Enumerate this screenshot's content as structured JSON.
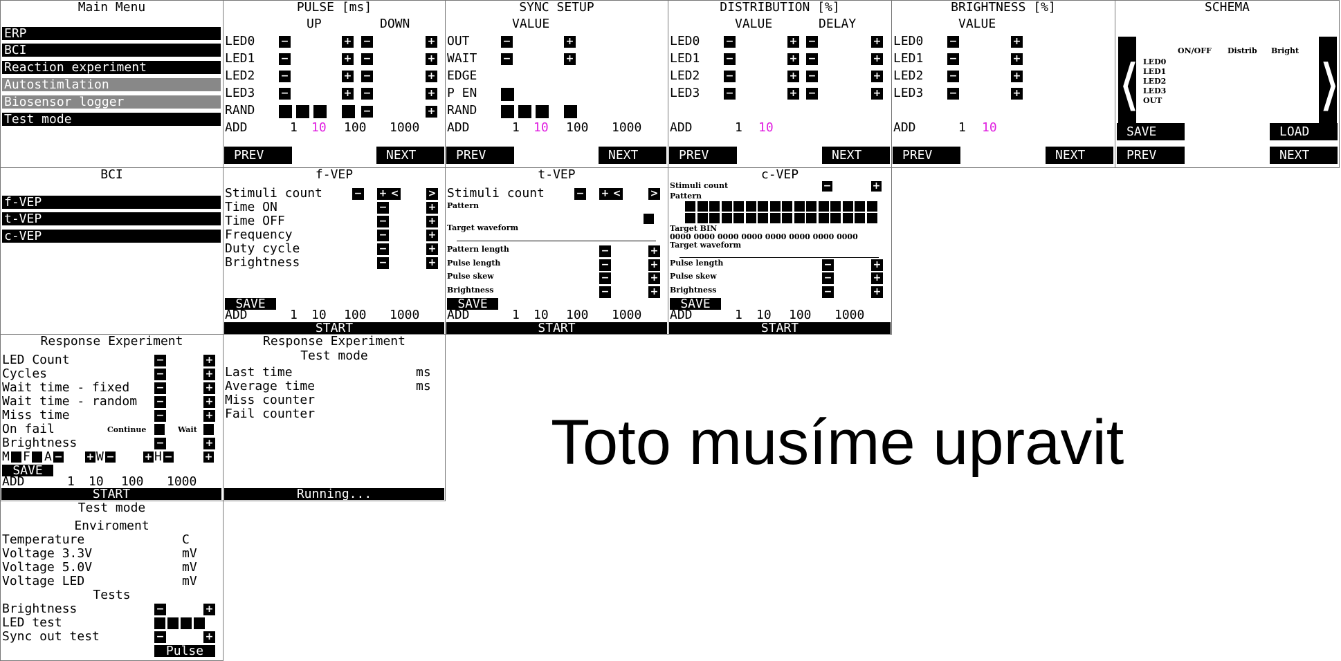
{
  "main_menu": {
    "title": "Main Menu",
    "items": [
      "ERP",
      "BCI",
      "Reaction experiment",
      "Autostimlation",
      "Biosensor logger",
      "Test mode"
    ]
  },
  "pulse": {
    "title": "PULSE [ms]",
    "col_up": "UP",
    "col_down": "DOWN",
    "rows": [
      "LED0",
      "LED1",
      "LED2",
      "LED3",
      "RAND"
    ]
  },
  "sync": {
    "title": "SYNC SETUP",
    "col_value": "VALUE",
    "rows": [
      "OUT",
      "WAIT",
      "EDGE",
      "P EN",
      "RAND"
    ]
  },
  "distribution": {
    "title": "DISTRIBUTION [%]",
    "col_value": "VALUE",
    "col_delay": "DELAY",
    "rows": [
      "LED0",
      "LED1",
      "LED2",
      "LED3"
    ]
  },
  "brightness": {
    "title": "BRIGHTNESS [%]",
    "col_value": "VALUE",
    "rows": [
      "LED0",
      "LED1",
      "LED2",
      "LED3"
    ]
  },
  "schema": {
    "title": "SCHEMA",
    "col_onoff": "ON/OFF",
    "col_distrib": "Distrib",
    "col_bright": "Bright",
    "rows": [
      "LED0",
      "LED1",
      "LED2",
      "LED3",
      "OUT"
    ],
    "save": "SAVE",
    "load": "LOAD",
    "prev_arrow": "⟨",
    "next_arrow": "⟩"
  },
  "common": {
    "add": "ADD",
    "steps": [
      "1",
      "10",
      "100",
      "1000"
    ],
    "prev": "PREV",
    "next": "NEXT",
    "save": "SAVE",
    "start": "START",
    "minus": "−",
    "plus": "+",
    "left": "<",
    "right": ">"
  },
  "bci": {
    "title": "BCI",
    "items": [
      "f-VEP",
      "t-VEP",
      "c-VEP"
    ]
  },
  "fvep": {
    "title": "f-VEP",
    "rows": [
      "Stimuli count",
      "Time ON",
      "Time OFF",
      "Frequency",
      "Duty cycle",
      "Brightness"
    ]
  },
  "tvep": {
    "title": "t-VEP",
    "stimuli": "Stimuli count",
    "pattern": "Pattern",
    "target": "Target waveform",
    "rows": [
      "Pattern length",
      "Pulse length",
      "Pulse skew",
      "Brightness"
    ]
  },
  "cvep": {
    "title": "c-VEP",
    "stimuli": "Stimuli count",
    "pattern": "Pattern",
    "target_bin": "Target BIN",
    "bin_value": "0000 0000 0000 0000 0000 0000 0000 0000",
    "target": "Target waveform",
    "rows": [
      "Pulse length",
      "Pulse skew",
      "Brightness"
    ]
  },
  "response": {
    "title": "Response Experiment",
    "rows": [
      "LED Count",
      "Cycles",
      "Wait time - fixed",
      "Wait time - random",
      "Miss time",
      "On fail",
      "Brightness"
    ],
    "continue": "Continue",
    "wait": "Wait",
    "m": "M",
    "f": "F",
    "a": "A",
    "w": "W",
    "h": "H"
  },
  "response_test": {
    "title": "Response Experiment",
    "subtitle": "Test mode",
    "rows": [
      "Last time",
      "Average time",
      "Miss counter",
      "Fail counter"
    ],
    "unit": "ms",
    "running": "Running..."
  },
  "test_mode": {
    "title": "Test mode",
    "env": "Enviroment",
    "temp": "Temperature",
    "v33": "Voltage 3.3V",
    "v50": "Voltage 5.0V",
    "vled": "Voltage LED",
    "unit_c": "C",
    "unit_mv": "mV",
    "tests": "Tests",
    "brightness": "Brightness",
    "led_test": "LED test",
    "sync_test": "Sync out test",
    "pulse": "Pulse"
  },
  "note": "Toto musíme upravit"
}
